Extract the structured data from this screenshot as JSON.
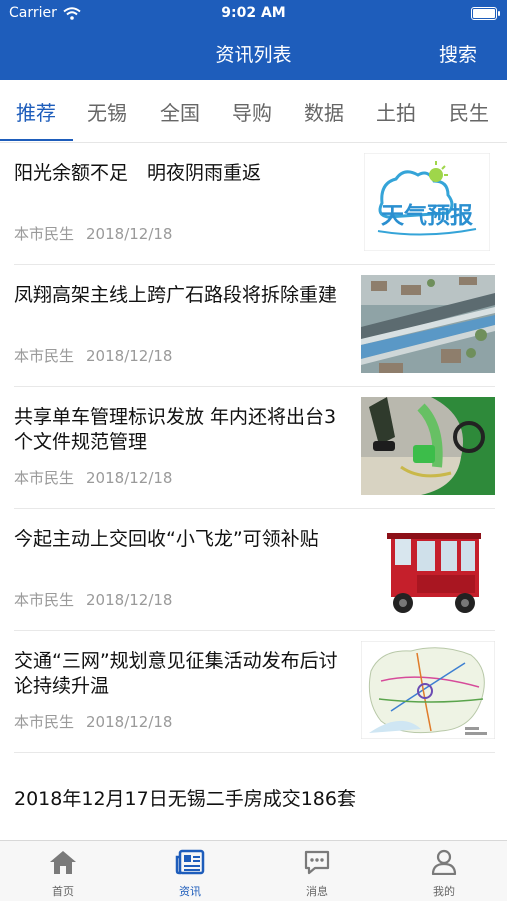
{
  "status_bar": {
    "carrier": "Carrier",
    "time": "9:02 AM"
  },
  "nav": {
    "title": "资讯列表",
    "search": "搜索"
  },
  "tabs": [
    "推荐",
    "无锡",
    "全国",
    "导购",
    "数据",
    "土拍",
    "民生"
  ],
  "articles": [
    {
      "title": "阳光余额不足　明夜阴雨重返",
      "source": "本市民生",
      "date": "2018/12/18",
      "thumb_text": "天气预报"
    },
    {
      "title": "凤翔高架主线上跨广石路段将拆除重建",
      "source": "本市民生",
      "date": "2018/12/18"
    },
    {
      "title": "共享单车管理标识发放 年内还将出台3个文件规范管理",
      "source": "本市民生",
      "date": "2018/12/18"
    },
    {
      "title": "今起主动上交回收“小飞龙”可领补贴",
      "source": "本市民生",
      "date": "2018/12/18"
    },
    {
      "title": "交通“三网”规划意见征集活动发布后讨论持续升温",
      "source": "本市民生",
      "date": "2018/12/18"
    }
  ],
  "last_article": {
    "title": "2018年12月17日无锡二手房成交186套"
  },
  "tabbar": [
    {
      "label": "首页",
      "icon": "home-icon"
    },
    {
      "label": "资讯",
      "icon": "news-icon"
    },
    {
      "label": "消息",
      "icon": "message-icon"
    },
    {
      "label": "我的",
      "icon": "profile-icon"
    }
  ],
  "colors": {
    "brand": "#1e5dbb",
    "text": "#111111",
    "meta": "#9a9a9a"
  }
}
